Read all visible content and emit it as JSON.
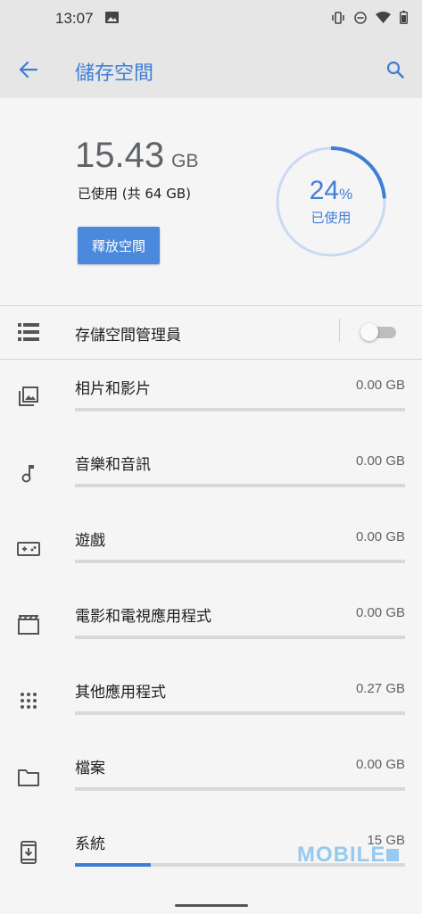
{
  "status_bar": {
    "time": "13:07"
  },
  "app_bar": {
    "title": "儲存空間"
  },
  "summary": {
    "used_value": "15.43",
    "used_unit": "GB",
    "used_desc": "已使用 (共 64 GB)",
    "free_button": "釋放空間",
    "percent_value": "24",
    "percent_sign": "%",
    "percent_fraction": 0.24,
    "percent_label": "已使用"
  },
  "manager": {
    "label": "存儲空間管理員",
    "enabled": false
  },
  "categories": [
    {
      "label": "相片和影片",
      "size": "0.00 GB",
      "fraction": 0.0,
      "icon": "photo-icon"
    },
    {
      "label": "音樂和音訊",
      "size": "0.00 GB",
      "fraction": 0.0,
      "icon": "music-note-icon"
    },
    {
      "label": "遊戲",
      "size": "0.00 GB",
      "fraction": 0.0,
      "icon": "gamepad-icon"
    },
    {
      "label": "電影和電視應用程式",
      "size": "0.00 GB",
      "fraction": 0.0,
      "icon": "movie-icon"
    },
    {
      "label": "其他應用程式",
      "size": "0.27 GB",
      "fraction": 0.0,
      "icon": "apps-grid-icon"
    },
    {
      "label": "檔案",
      "size": "0.00 GB",
      "fraction": 0.0,
      "icon": "folder-icon"
    },
    {
      "label": "系統",
      "size": "15 GB",
      "fraction": 0.23,
      "icon": "system-update-icon"
    }
  ],
  "watermark": "MOBILE",
  "colors": {
    "accent": "#3f7ed6",
    "button": "#4a89dc",
    "track": "#d9d9d9",
    "ring_track": "#c9daf2"
  }
}
